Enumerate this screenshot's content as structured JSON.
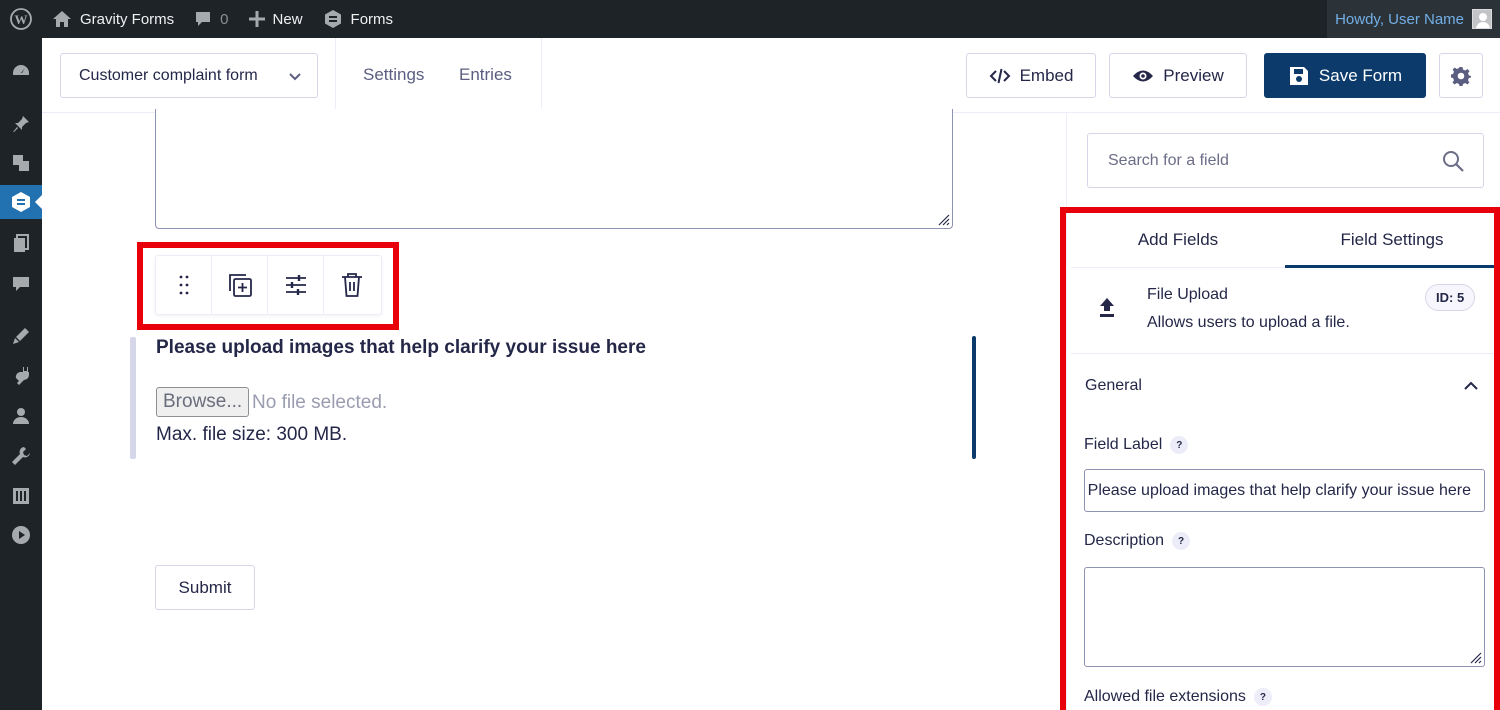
{
  "adminbar": {
    "site_name": "Gravity Forms",
    "comments_count": "0",
    "new_label": "New",
    "forms_label": "Forms",
    "howdy": "Howdy, User Name"
  },
  "sidemenu": {
    "icons": [
      "dashboard-icon",
      "pin-icon",
      "media-icon",
      "gravity-forms-icon",
      "pages-icon",
      "comments-icon",
      "appearance-icon",
      "plugins-icon",
      "users-icon",
      "tools-icon",
      "settings-icon",
      "collapse-icon"
    ],
    "active": "gravity-forms-icon"
  },
  "toolbar": {
    "form_name": "Customer complaint form",
    "settings_label": "Settings",
    "entries_label": "Entries",
    "embed_label": "Embed",
    "preview_label": "Preview",
    "save_label": "Save Form"
  },
  "canvas": {
    "field_label": "Please upload images that help clarify your issue here",
    "browse_label": "Browse...",
    "no_file_text": "No file selected.",
    "max_size_text": "Max. file size: 300 MB.",
    "submit_label": "Submit",
    "field_tools": [
      "drag-handle-icon",
      "duplicate-icon",
      "settings-sliders-icon",
      "trash-icon"
    ]
  },
  "panel": {
    "search_placeholder": "Search for a field",
    "tabs": [
      {
        "label": "Add Fields",
        "active": false
      },
      {
        "label": "Field Settings",
        "active": true
      }
    ],
    "field_type": {
      "name": "File Upload",
      "description": "Allows users to upload a file.",
      "id_badge": "ID: 5"
    },
    "section_title": "General",
    "field_label_label": "Field Label",
    "field_label_value": "Please upload images that help clarify your issue here",
    "description_label": "Description",
    "allowed_ext_label": "Allowed file extensions",
    "help": "?"
  },
  "colors": {
    "accent": "#0b3a6b",
    "highlight": "#e8000b",
    "adminbar": "#1d2327"
  }
}
